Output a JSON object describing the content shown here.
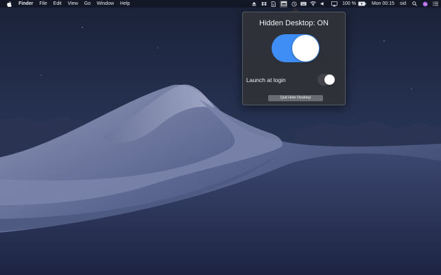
{
  "menubar": {
    "app_name": "Finder",
    "items": [
      "File",
      "Edit",
      "View",
      "Go",
      "Window",
      "Help"
    ],
    "status_icons": [
      "eject-icon",
      "dropbox-icon",
      "document-icon",
      "hide-desktop-icon",
      "time-machine-icon",
      "keyboard-icon",
      "wifi-icon",
      "volume-icon",
      "airplay-icon"
    ],
    "battery_text": "100 %",
    "clock": "Mon 00:15",
    "user": "sid"
  },
  "popover": {
    "title": "Hidden Desktop: ON",
    "main_toggle_on": true,
    "launch_label": "Launch at login",
    "launch_toggle_on": false,
    "quit_label": "Quit Hide Desktop"
  },
  "colors": {
    "toggle_on": "#3e8ef5",
    "popover_bg": "#303238",
    "sky_top": "#1a2238"
  }
}
